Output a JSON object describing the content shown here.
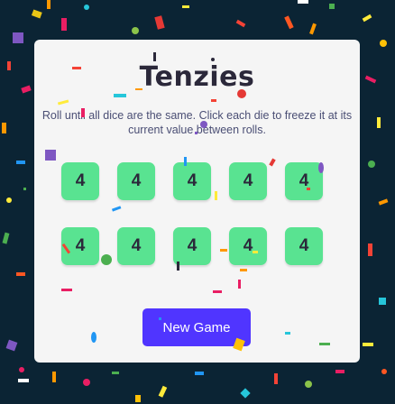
{
  "game": {
    "title": "Tenzies",
    "instructions": "Roll until all dice are the same. Click each die to freeze it at its current value between rolls.",
    "dice": [
      4,
      4,
      4,
      4,
      4,
      4,
      4,
      4,
      4,
      4
    ],
    "new_game_label": "New Game"
  },
  "colors": {
    "background": "#0b2434",
    "board": "#f5f5f5",
    "die_held": "#59e391",
    "button": "#5035ff",
    "text": "#2b283a"
  }
}
